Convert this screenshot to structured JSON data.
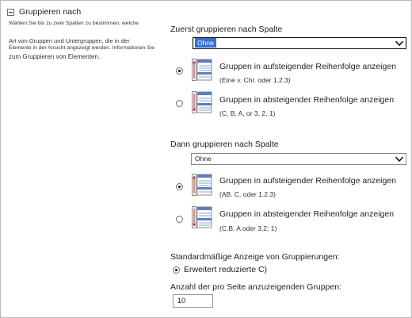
{
  "left": {
    "section_title": "Gruppieren nach",
    "description_lines": [
      "Wählen Sie bis zu zwei Spalten zu bestimmen, welche",
      "Art von Gruppen und Untergruppen, die in der",
      "Elemente in der Ansicht angezeigt werden. Informationen Sie",
      "zum Gruppieren von Elementen."
    ]
  },
  "first": {
    "label": "Zuerst gruppieren nach Spalte",
    "select_value": "Ohne",
    "asc_title": "Gruppen in aufsteigender Reihenfolge anzeigen",
    "asc_sub": "(Eine v. Chr. oder 1.2.3)",
    "desc_title": "Gruppen in absteigender Reihenfolge anzeigen",
    "desc_sub": "(C, B, A, or 3, 2, 1)"
  },
  "second": {
    "label": "Dann gruppieren nach Spalte",
    "select_value": "Ohne",
    "asc_title": "Gruppen in aufsteigender Reihenfolge anzeigen",
    "asc_sub": "(AB. C. oder 1.2.3)",
    "desc_title": "Gruppen in absteigender Reihenfolge anzeigen",
    "desc_sub": "(C.B. A oder 3,2; 1)"
  },
  "default_display": {
    "label": "Standardmäßige Anzeige von Gruppierungen:",
    "option": "Erweitert reduzierte C)"
  },
  "groups_per_page": {
    "label": "Anzahl der pro Seite anzuzeigenden Gruppen:",
    "value": "10"
  },
  "icons": [
    "collapse-icon",
    "sort-ascending-icon",
    "sort-descending-icon",
    "dropdown-arrow-icon"
  ],
  "colors": {
    "select_highlight": "#3a6fd2",
    "arrow_red": "#d42b2b",
    "icon_blue": "#5a7fc0"
  }
}
